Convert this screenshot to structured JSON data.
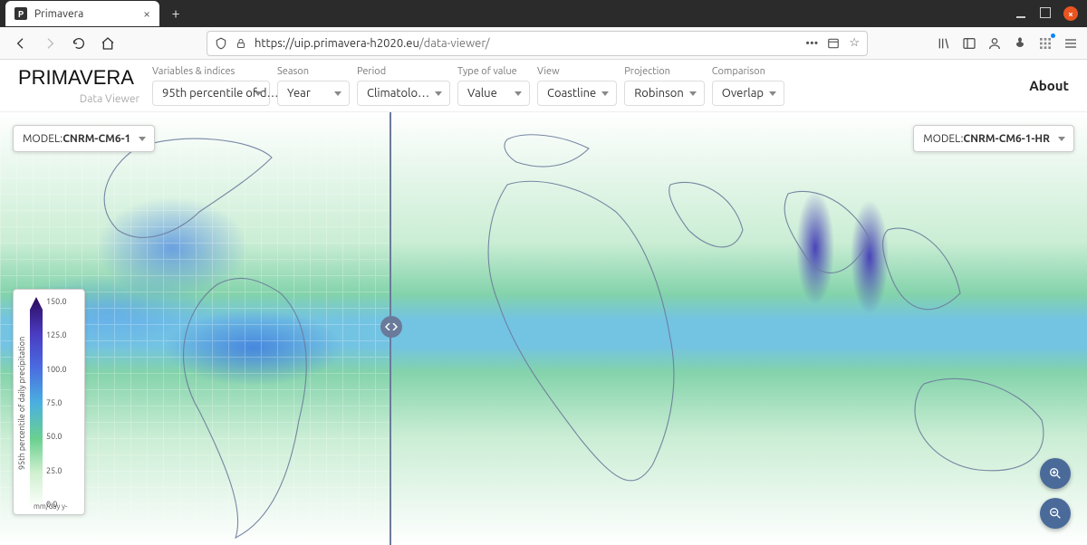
{
  "browser": {
    "tab_title": "Primavera",
    "url_display_host": "https://uip.primavera-h2020.eu",
    "url_display_path": "/data-viewer/"
  },
  "app": {
    "logo_main": "PRIMAVER",
    "logo_accent": "A",
    "logo_sub": "Data Viewer",
    "about": "About"
  },
  "controls": {
    "variables": {
      "label": "Variables & indices",
      "value": "95th percentile of d…"
    },
    "season": {
      "label": "Season",
      "value": "Year"
    },
    "period": {
      "label": "Period",
      "value": "Climatolo…"
    },
    "type": {
      "label": "Type of value",
      "value": "Value"
    },
    "view": {
      "label": "View",
      "value": "Coastline"
    },
    "projection": {
      "label": "Projection",
      "value": "Robinson"
    },
    "comparison": {
      "label": "Comparison",
      "value": "Overlap"
    }
  },
  "models": {
    "left_prefix": "MODEL: ",
    "left_value": "CNRM-CM6-1",
    "right_prefix": "MODEL: ",
    "right_value": "CNRM-CM6-1-HR"
  },
  "legend": {
    "title": "95th percentile of daily precipitation",
    "ticks": [
      "150.0",
      "125.0",
      "100.0",
      "75.0",
      "50.0",
      "25.0",
      "0.0"
    ],
    "unit": "mm/day y-"
  }
}
